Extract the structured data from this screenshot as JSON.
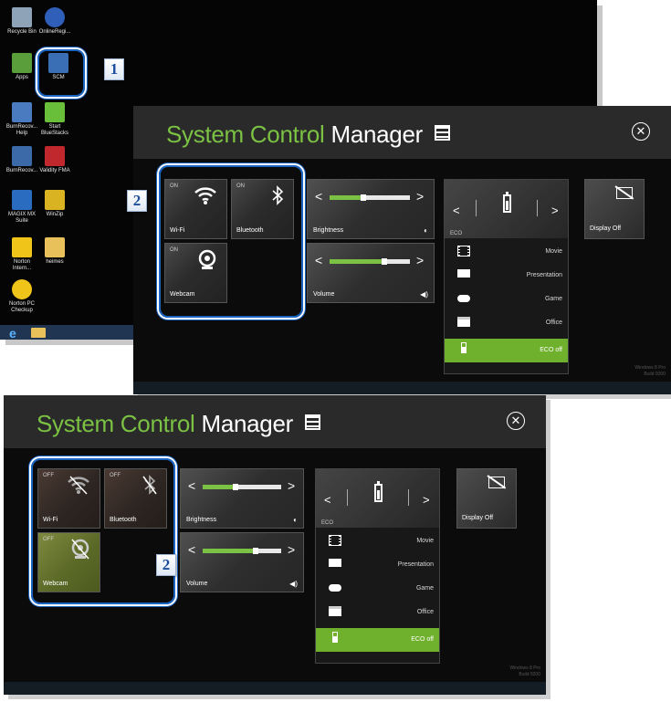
{
  "desktop_icons": [
    {
      "label": "Recycle Bin",
      "color": "#8fa3b8"
    },
    {
      "label": "OnlineRegi...",
      "color": "#2f5fb8"
    },
    {
      "label": "Apps",
      "color": "#5a9e3c"
    },
    {
      "label": "SCM",
      "color": "#3b6fb5"
    },
    {
      "label": "BurnRecov... Help",
      "color": "#4a7bc0"
    },
    {
      "label": "Start BlueStacks",
      "color": "#6abf3a"
    },
    {
      "label": "BurnRecov...",
      "color": "#3c6aa8"
    },
    {
      "label": "Validity FMA",
      "color": "#c0282d"
    },
    {
      "label": "MAGIX MX Suite",
      "color": "#2a6cc0"
    },
    {
      "label": "WinZip",
      "color": "#d9b322"
    },
    {
      "label": "Norton Intern...",
      "color": "#f0c419"
    },
    {
      "label": "heimes",
      "color": "#e8c15a"
    },
    {
      "label": "Norton PC Checkup",
      "color": "#f0c419"
    }
  ],
  "callouts": {
    "step1": "1",
    "step2": "2"
  },
  "scm": {
    "title_green": "System Control",
    "title_white": "Manager",
    "close": "✕",
    "on_state": "ON",
    "off_state": "OFF",
    "wifi": "Wi-Fi",
    "bluetooth": "Bluetooth",
    "webcam": "Webcam",
    "brightness": "Brightness",
    "volume": "Volume",
    "brightness_level": 0.42,
    "volume_level": 0.68,
    "eco_mode_label": "ECO",
    "eco_rows": [
      "Movie",
      "Presentation",
      "Game",
      "Office",
      "ECO off"
    ],
    "eco_selected": "ECO off",
    "display_off": "Display Off",
    "wifi_icon": "wifi-icon",
    "bluetooth_icon": "bluetooth-icon",
    "webcam_icon": "webcam-icon"
  },
  "watermark": {
    "line1": "Windows 8 Pro",
    "line2": "Build 9200"
  },
  "colors": {
    "accent_green": "#7bc143",
    "eco_selected_bg": "#6fb02c",
    "callout_blue": "#1a64c2"
  }
}
